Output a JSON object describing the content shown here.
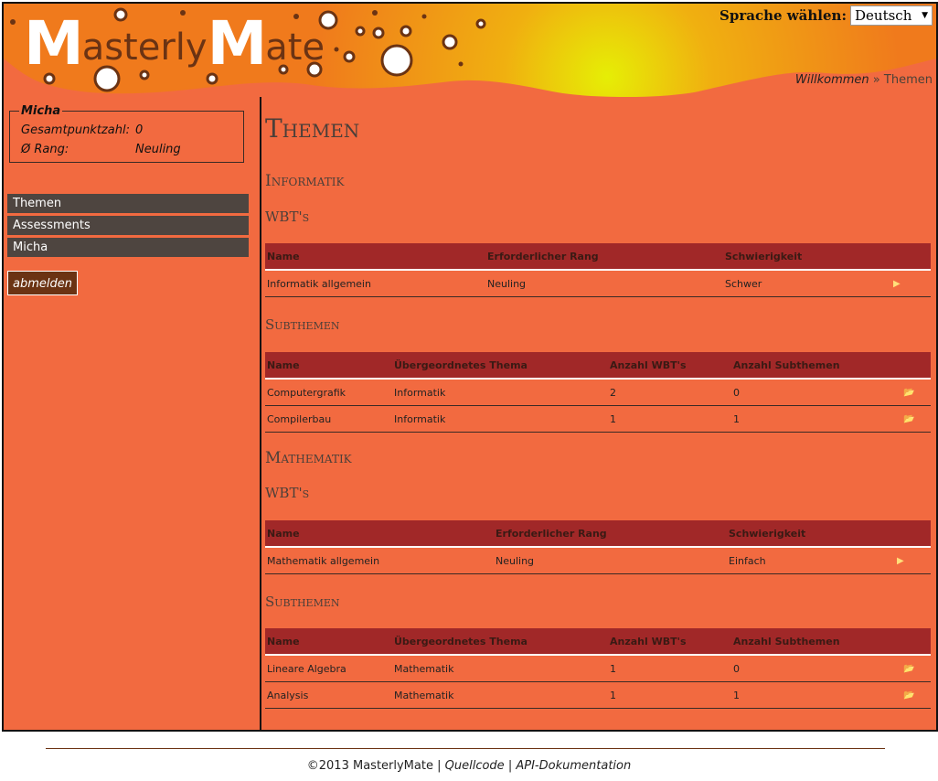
{
  "logo": {
    "m1": "M",
    "text1": "asterly",
    "m2": "M",
    "text2": "ate"
  },
  "language": {
    "label": "Sprache wählen:",
    "selected": "Deutsch"
  },
  "breadcrumb": {
    "home": "Willkommen",
    "separator": "»",
    "current": "Themen"
  },
  "user": {
    "name": "Micha",
    "points_label": "Gesamtpunktzahl:",
    "points_value": "0",
    "rank_label": "Ø Rang:",
    "rank_value": "Neuling"
  },
  "nav": [
    "Themen",
    "Assessments",
    "Micha"
  ],
  "logout": "abmelden",
  "page_title": "Themen",
  "wbt_headers": [
    "Name",
    "Erforderlicher Rang",
    "Schwierigkeit"
  ],
  "sub_headers": [
    "Name",
    "Übergeordnetes Thema",
    "Anzahl WBT's",
    "Anzahl Subthemen"
  ],
  "sections": [
    {
      "title": "Informatik",
      "wbt_label": "WBT's",
      "wbts": [
        {
          "name": "Informatik allgemein",
          "rank": "Neuling",
          "difficulty": "Schwer",
          "icon": "play-icon"
        }
      ],
      "sub_label": "Subthemen",
      "subtopics": [
        {
          "name": "Computergrafik",
          "parent": "Informatik",
          "wbts": "2",
          "subs": "0",
          "icon": "folder-open-icon"
        },
        {
          "name": "Compilerbau",
          "parent": "Informatik",
          "wbts": "1",
          "subs": "1",
          "icon": "folder-open-icon"
        }
      ]
    },
    {
      "title": "Mathematik",
      "wbt_label": "WBT's",
      "wbts": [
        {
          "name": "Mathematik allgemein",
          "rank": "Neuling",
          "difficulty": "Einfach",
          "icon": "play-icon"
        }
      ],
      "sub_label": "Subthemen",
      "subtopics": [
        {
          "name": "Lineare Algebra",
          "parent": "Mathematik",
          "wbts": "1",
          "subs": "0",
          "icon": "folder-open-icon"
        },
        {
          "name": "Analysis",
          "parent": "Mathematik",
          "wbts": "1",
          "subs": "1",
          "icon": "folder-open-icon"
        }
      ]
    }
  ],
  "footer": {
    "copyright": "©2013 MasterlyMate",
    "sep": "|",
    "source": "Quellcode",
    "api": "API-Dokumentation"
  },
  "colors": {
    "background": "#f26a40",
    "nav": "#4e4540",
    "table_header": "#a12828",
    "logo_brown": "#6b3313",
    "sun": "#e8ec0a"
  }
}
